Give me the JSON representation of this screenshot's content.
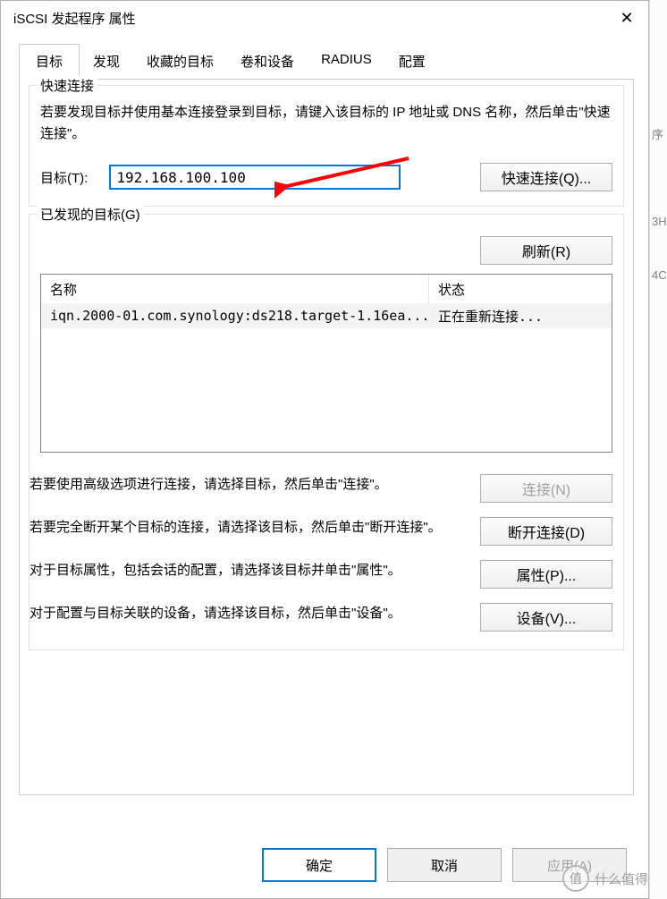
{
  "window": {
    "title": "iSCSI 发起程序 属性",
    "close": "✕"
  },
  "tabs": {
    "items": [
      {
        "label": "目标"
      },
      {
        "label": "发现"
      },
      {
        "label": "收藏的目标"
      },
      {
        "label": "卷和设备"
      },
      {
        "label": "RADIUS"
      },
      {
        "label": "配置"
      }
    ]
  },
  "quick_connect": {
    "group_title": "快速连接",
    "help": "若要发现目标并使用基本连接登录到目标，请键入该目标的 IP 地址或 DNS 名称，然后单击\"快速连接\"。",
    "target_label": "目标(T):",
    "target_value": "192.168.100.100",
    "button": "快速连接(Q)..."
  },
  "discovered": {
    "group_title": "已发现的目标(G)",
    "refresh": "刷新(R)",
    "columns": {
      "name": "名称",
      "status": "状态"
    },
    "rows": [
      {
        "name": "iqn.2000-01.com.synology:ds218.target-1.16ea...",
        "status": "正在重新连接..."
      }
    ]
  },
  "actions": {
    "connect_help": "若要使用高级选项进行连接，请选择目标，然后单击\"连接\"。",
    "connect_btn": "连接(N)",
    "disconnect_help": "若要完全断开某个目标的连接，请选择该目标，然后单击\"断开连接\"。",
    "disconnect_btn": "断开连接(D)",
    "props_help": "对于目标属性，包括会话的配置，请选择该目标并单击\"属性\"。",
    "props_btn": "属性(P)...",
    "devices_help": "对于配置与目标关联的设备，请选择该目标，然后单击\"设备\"。",
    "devices_btn": "设备(V)..."
  },
  "dialog_buttons": {
    "ok": "确定",
    "cancel": "取消",
    "apply": "应用(A)"
  },
  "watermark": {
    "circle": "值",
    "text": "什么值得买"
  },
  "side": {
    "f1": "序",
    "f2": "3H",
    "f3": "4C"
  }
}
